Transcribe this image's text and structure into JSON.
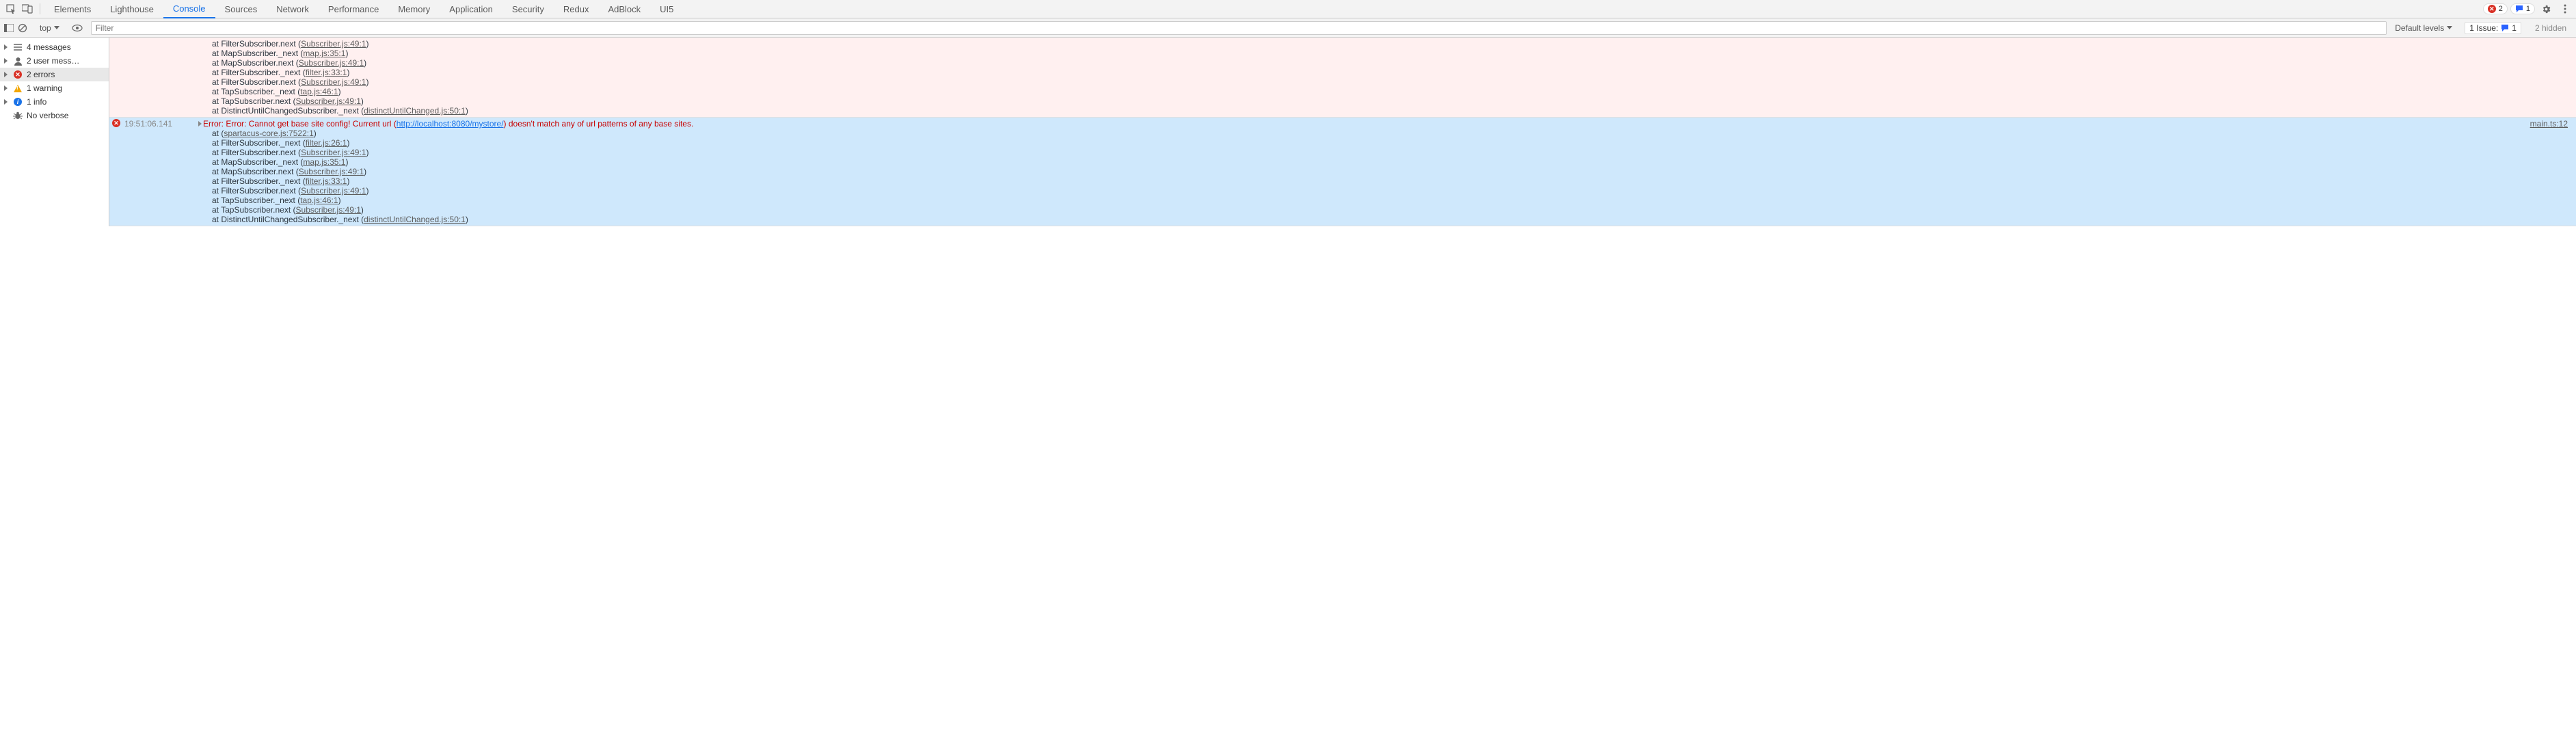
{
  "tabs": [
    "Elements",
    "Lighthouse",
    "Console",
    "Sources",
    "Network",
    "Performance",
    "Memory",
    "Application",
    "Security",
    "Redux",
    "AdBlock",
    "UI5"
  ],
  "activeTab": "Console",
  "topRight": {
    "errors": "2",
    "messages": "1"
  },
  "sub": {
    "context": "top",
    "filterPlaceholder": "Filter",
    "levels": "Default levels",
    "issuesLabel": "1 Issue:",
    "issuesCount": "1",
    "hidden": "2 hidden"
  },
  "sidebar": [
    {
      "icon": "messages",
      "label": "4 messages",
      "arrow": true
    },
    {
      "icon": "user",
      "label": "2 user mess…",
      "arrow": true
    },
    {
      "icon": "error",
      "label": "2 errors",
      "arrow": true,
      "selected": true
    },
    {
      "icon": "warn",
      "label": "1 warning",
      "arrow": true
    },
    {
      "icon": "info",
      "label": "1 info",
      "arrow": true
    },
    {
      "icon": "bug",
      "label": "No verbose",
      "arrow": false
    }
  ],
  "entries": [
    {
      "type": "err-light",
      "stack": [
        {
          "at": "FilterSubscriber.next",
          "src": "Subscriber.js:49:1"
        },
        {
          "at": "MapSubscriber._next",
          "src": "map.js:35:1"
        },
        {
          "at": "MapSubscriber.next",
          "src": "Subscriber.js:49:1"
        },
        {
          "at": "FilterSubscriber._next",
          "src": "filter.js:33:1"
        },
        {
          "at": "FilterSubscriber.next",
          "src": "Subscriber.js:49:1"
        },
        {
          "at": "TapSubscriber._next",
          "src": "tap.js:46:1"
        },
        {
          "at": "TapSubscriber.next",
          "src": "Subscriber.js:49:1"
        },
        {
          "at": "DistinctUntilChangedSubscriber._next",
          "src": "distinctUntilChanged.js:50:1"
        }
      ]
    },
    {
      "type": "err-sel",
      "timestamp": "19:51:06.141",
      "msgPre": "Error: Error: Cannot get base site config! Current url (",
      "msgUrl": "http://localhost:8080/mystore/",
      "msgPost": ") doesn't match any of url patterns of any base sites.",
      "src": "main.ts:12",
      "stack": [
        {
          "at": "",
          "src": "spartacus-core.js:7522:1"
        },
        {
          "at": "FilterSubscriber._next",
          "src": "filter.js:26:1"
        },
        {
          "at": "FilterSubscriber.next",
          "src": "Subscriber.js:49:1"
        },
        {
          "at": "MapSubscriber._next",
          "src": "map.js:35:1"
        },
        {
          "at": "MapSubscriber.next",
          "src": "Subscriber.js:49:1"
        },
        {
          "at": "FilterSubscriber._next",
          "src": "filter.js:33:1"
        },
        {
          "at": "FilterSubscriber.next",
          "src": "Subscriber.js:49:1"
        },
        {
          "at": "TapSubscriber._next",
          "src": "tap.js:46:1"
        },
        {
          "at": "TapSubscriber.next",
          "src": "Subscriber.js:49:1"
        },
        {
          "at": "DistinctUntilChangedSubscriber._next",
          "src": "distinctUntilChanged.js:50:1"
        }
      ]
    }
  ]
}
